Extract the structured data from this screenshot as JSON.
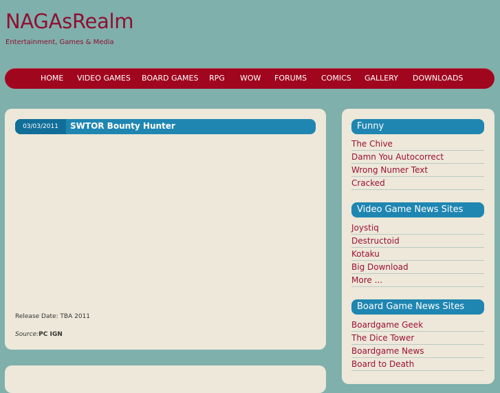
{
  "site": {
    "title": "NAGAsRealm",
    "tagline": "Entertainment, Games & Media"
  },
  "nav": {
    "items": [
      "HOME",
      "VIDEO GAMES",
      "BOARD GAMES",
      "RPG",
      "WOW",
      "FORUMS",
      "COMICS",
      "GALLERY",
      "DOWNLOADS"
    ]
  },
  "post": {
    "date": "03/03/2011",
    "title": "SWTOR Bounty Hunter",
    "release": "Release Date: TBA 2011",
    "source_label": "Source:",
    "source_value": "PC IGN"
  },
  "sidebar": {
    "boxes": [
      {
        "title": "Funny",
        "links": [
          "The Chive",
          "Damn You Autocorrect",
          "Wrong Numer Text",
          "Cracked"
        ]
      },
      {
        "title": "Video Game News Sites",
        "links": [
          "Joystiq",
          "Destructoid",
          "Kotaku",
          "Big Download",
          "More ..."
        ]
      },
      {
        "title": "Board Game News Sites",
        "links": [
          "Boardgame Geek",
          "The Dice Tower",
          "Boardgame News",
          "Board to Death"
        ]
      }
    ]
  },
  "colors": {
    "background": "#7fb0ac",
    "brand": "#8e1030",
    "nav": "#a0061e",
    "accent": "#1f86b2",
    "panel": "#ede8d9"
  }
}
